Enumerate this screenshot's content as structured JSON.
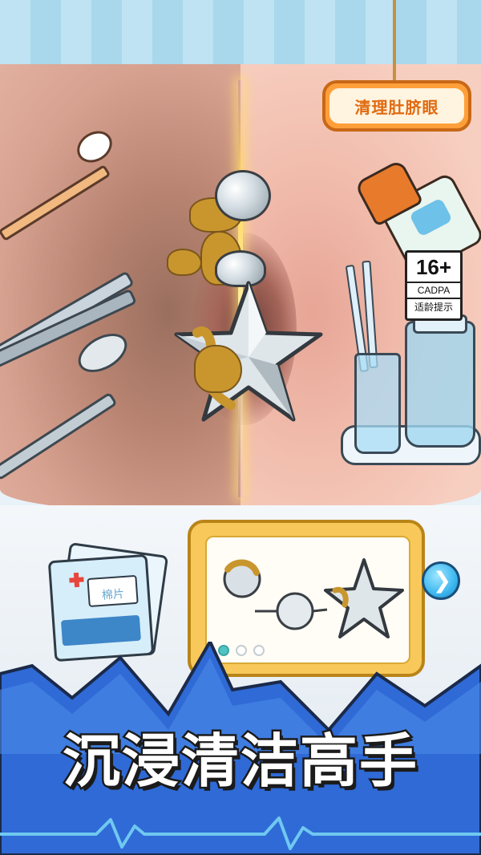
{
  "game": {
    "title_sign": "清理肚脐眼",
    "slogan": "沉浸清洁高手"
  },
  "age_rating": {
    "number": "16+",
    "org": "CADPA",
    "hint": "适龄提示"
  },
  "cotton_packet": {
    "label": "棉片"
  },
  "preview": {
    "page_count": 3,
    "active_page": 1
  },
  "icons": {
    "next": "chevron-right-icon"
  },
  "colors": {
    "sign_orange": "#ff9f3a",
    "slogan_fill": "#ffffff",
    "mountain_blue": "#2f6ad6",
    "accent_teal": "#4fc4c2"
  }
}
